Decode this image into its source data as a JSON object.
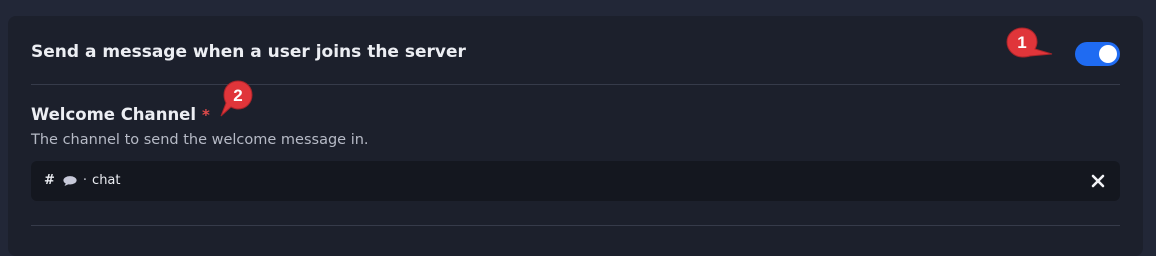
{
  "welcome_section": {
    "toggle_title": "Send a message when a user joins the server",
    "toggle_enabled": true,
    "channel_field": {
      "label": "Welcome Channel",
      "required_mark": "*",
      "description": "The channel to send the welcome message in.",
      "selected": {
        "prefix": "#",
        "icon": "speech-bubble-icon",
        "separator": "·",
        "name": "chat"
      },
      "clear_icon": "close-icon"
    }
  },
  "annotations": [
    {
      "label": "1",
      "color": "#e0353a"
    },
    {
      "label": "2",
      "color": "#e0353a"
    }
  ],
  "colors": {
    "page_bg": "#222737",
    "card_bg": "#1c202c",
    "toggle_on": "#1f6bf2",
    "required": "#e24b4b",
    "input_bg": "#14171f"
  }
}
